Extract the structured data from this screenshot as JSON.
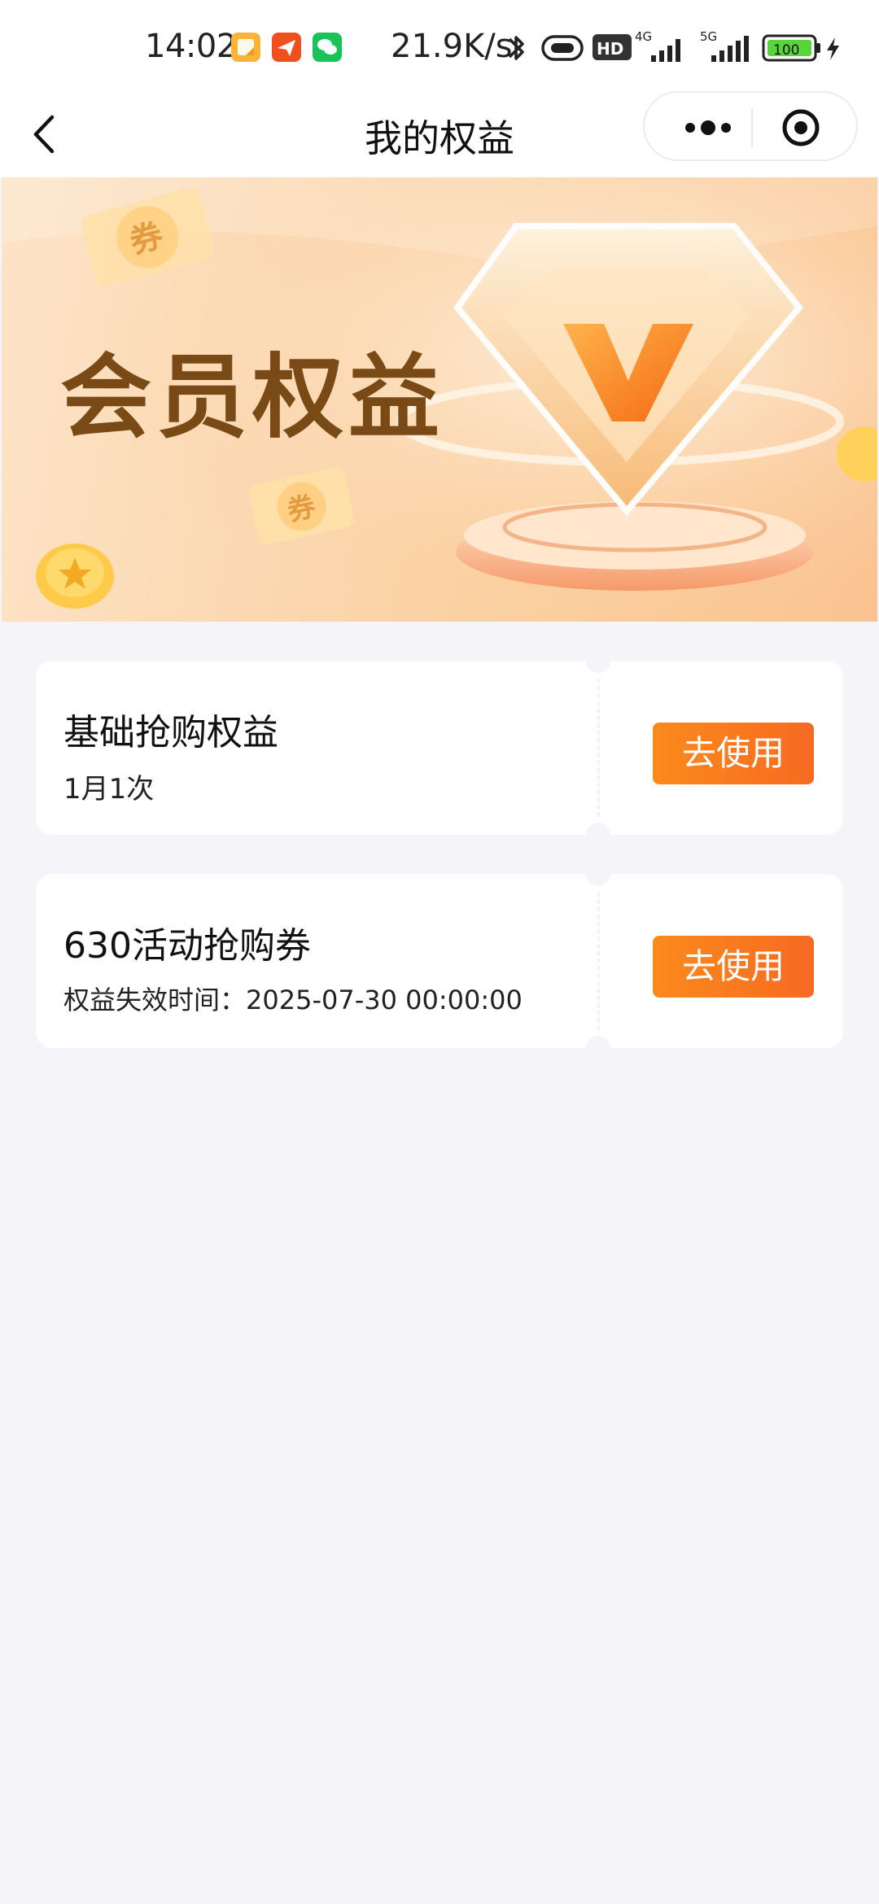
{
  "status_bar": {
    "time": "14:02",
    "net_speed": "21.9K/s",
    "battery": "100",
    "network_1": "4G",
    "network_2": "5G",
    "hd_label": "HD",
    "icons": [
      "note-app-icon",
      "send-app-icon",
      "wechat-icon",
      "bluetooth-icon",
      "vibrate-icon",
      "hd-icon",
      "signal-icon",
      "signal-5g-icon",
      "battery-icon",
      "charging-icon"
    ]
  },
  "navbar": {
    "title": "我的权益",
    "icons": [
      "back-arrow-icon",
      "more-dots-icon",
      "target-close-icon"
    ]
  },
  "banner": {
    "title": "会员权益",
    "coupon_char": "券"
  },
  "benefits": [
    {
      "title": "基础抢购权益",
      "subtitle": "1月1次",
      "button": "去使用"
    },
    {
      "title": "630活动抢购券",
      "subtitle": "权益失效时间：2025-07-30 00:00:00",
      "button": "去使用"
    }
  ],
  "colors": {
    "accent_orange": "#f97a1f",
    "page_bg": "#f4f4f9",
    "banner_title": "#7a4a16"
  }
}
